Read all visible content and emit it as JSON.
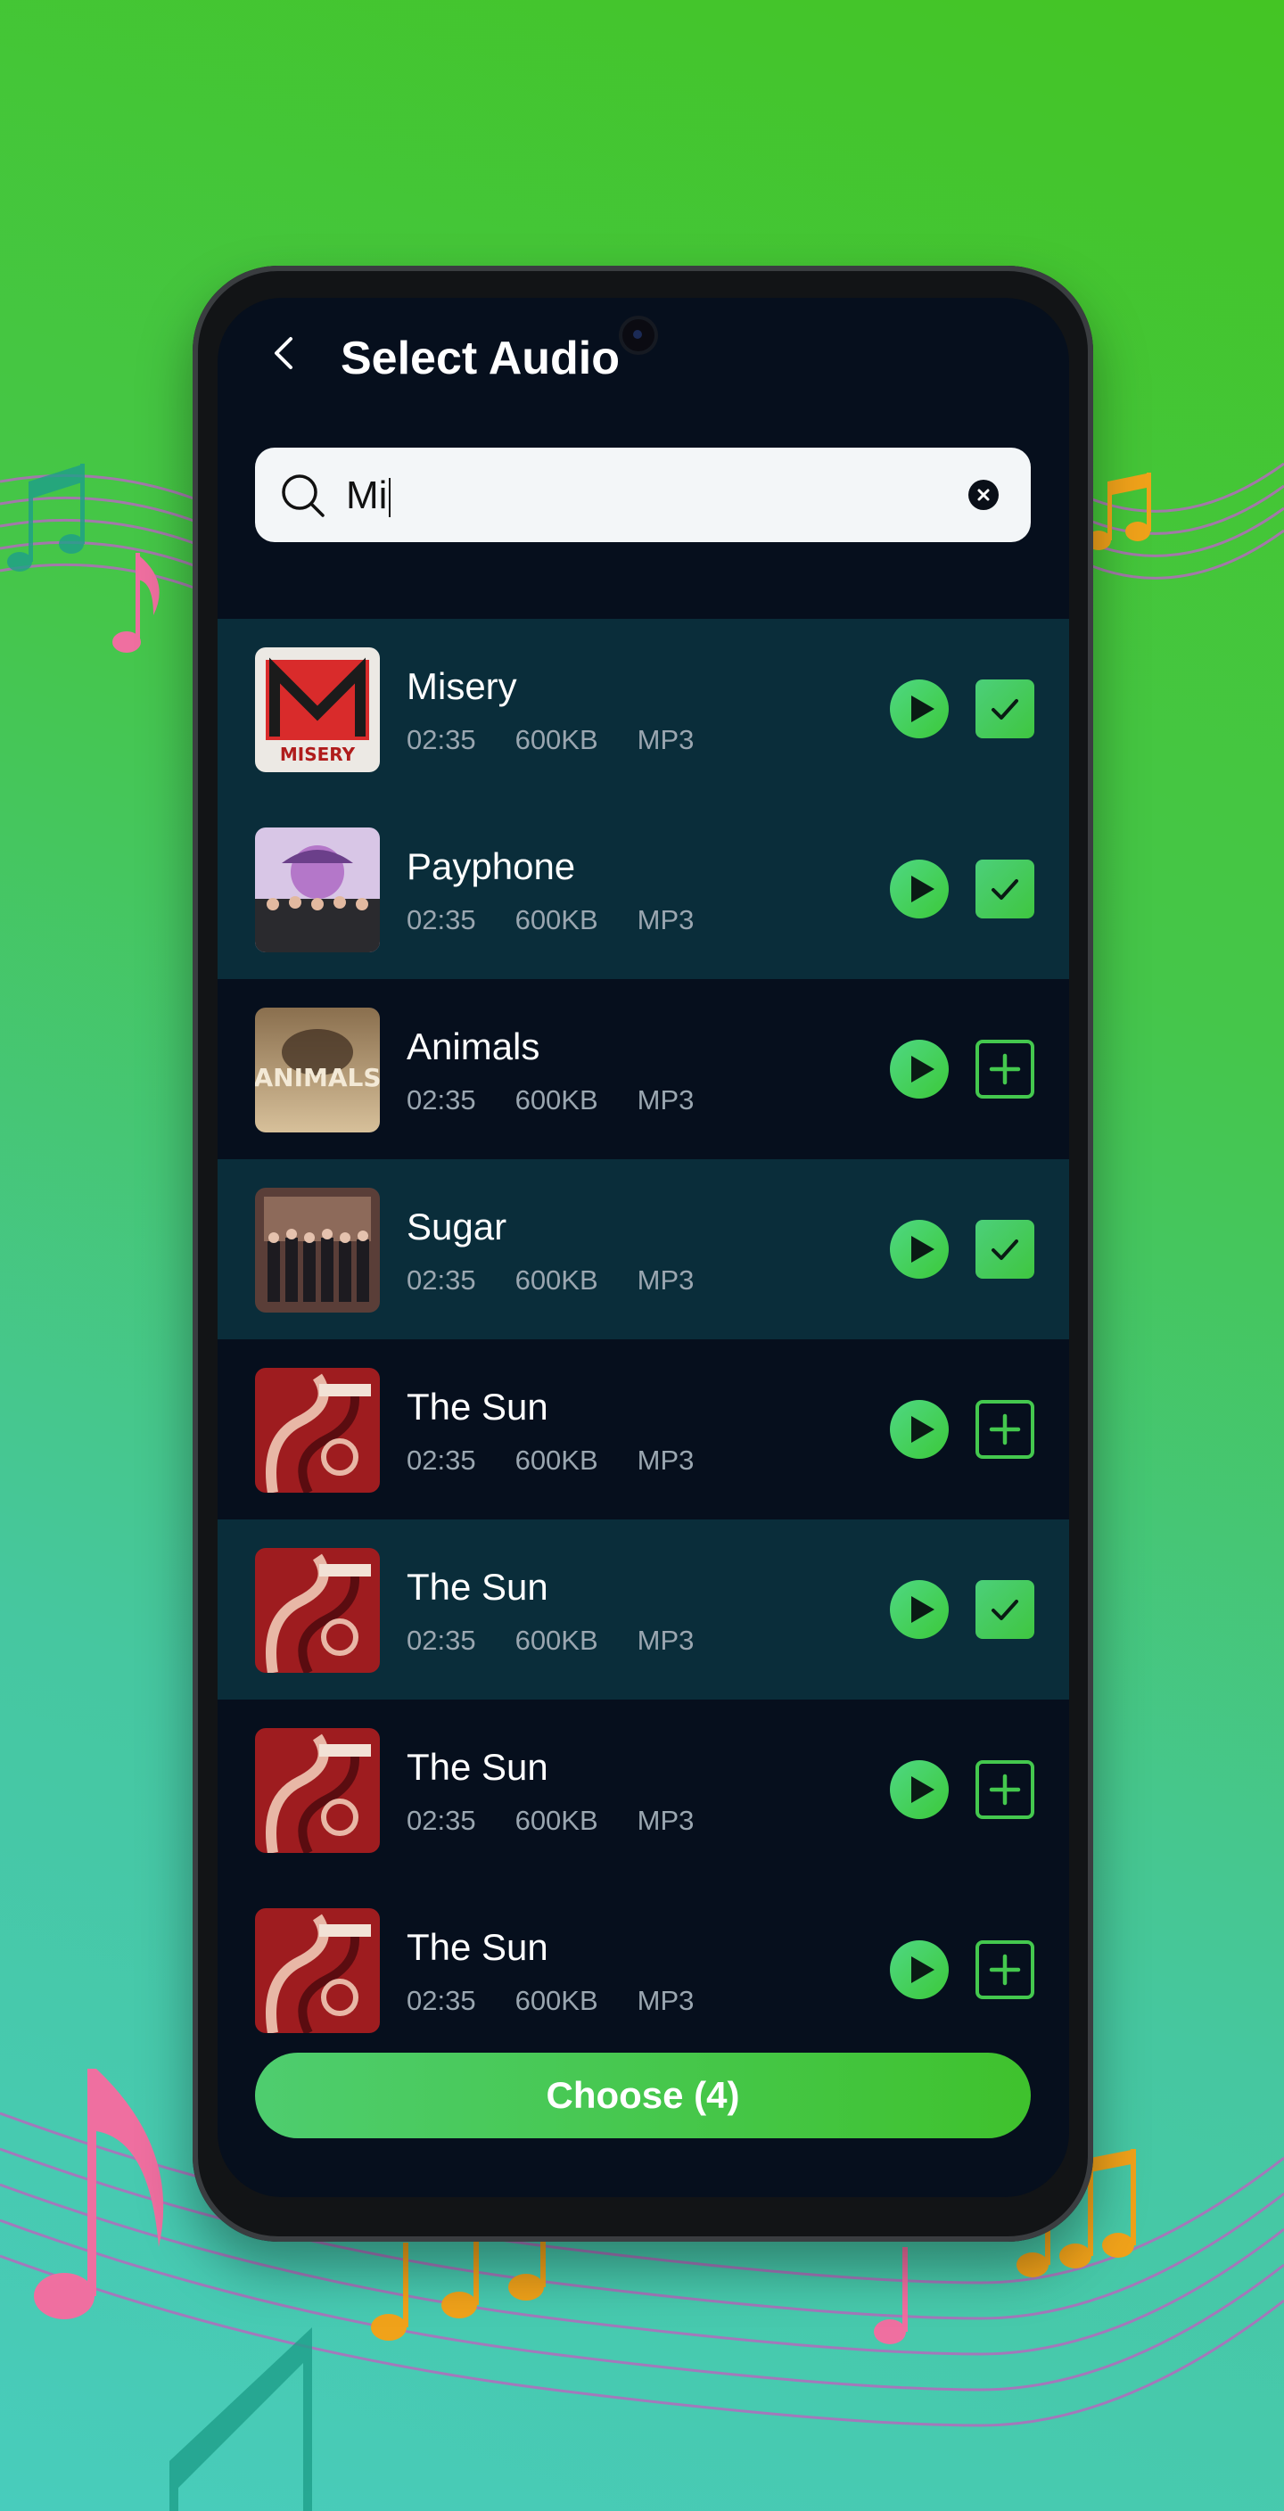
{
  "header": {
    "title": "Select Audio"
  },
  "search": {
    "query": "Mi"
  },
  "songs": [
    {
      "title": "Misery",
      "duration": "02:35",
      "size": "600KB",
      "format": "MP3",
      "selected": true,
      "art": "misery"
    },
    {
      "title": "Payphone",
      "duration": "02:35",
      "size": "600KB",
      "format": "MP3",
      "selected": true,
      "art": "payphone"
    },
    {
      "title": "Animals",
      "duration": "02:35",
      "size": "600KB",
      "format": "MP3",
      "selected": false,
      "art": "animals"
    },
    {
      "title": "Sugar",
      "duration": "02:35",
      "size": "600KB",
      "format": "MP3",
      "selected": true,
      "art": "sugar"
    },
    {
      "title": "The Sun",
      "duration": "02:35",
      "size": "600KB",
      "format": "MP3",
      "selected": false,
      "art": "sun"
    },
    {
      "title": "The Sun",
      "duration": "02:35",
      "size": "600KB",
      "format": "MP3",
      "selected": true,
      "art": "sun"
    },
    {
      "title": "The Sun",
      "duration": "02:35",
      "size": "600KB",
      "format": "MP3",
      "selected": false,
      "art": "sun"
    },
    {
      "title": "The Sun",
      "duration": "02:35",
      "size": "600KB",
      "format": "MP3",
      "selected": false,
      "art": "sun"
    }
  ],
  "footer": {
    "choose_label": "Choose (4)"
  },
  "colors": {
    "accent": "#44c84e",
    "screen_bg": "#060f1d",
    "selected_row_bg": "#0a2d3a"
  },
  "icons": {
    "back": "chevron-left-icon",
    "search": "search-icon",
    "clear": "clear-icon",
    "play": "play-icon",
    "check": "check-icon",
    "add": "plus-icon"
  }
}
